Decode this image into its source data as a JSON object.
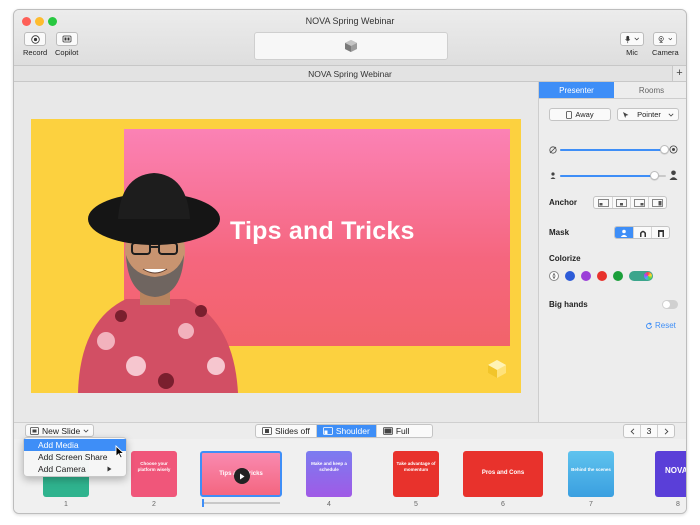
{
  "window": {
    "title": "NOVA Spring Webinar"
  },
  "toolbar": {
    "record_label": "Record",
    "copilot_label": "Copilot",
    "mic_label": "Mic",
    "camera_label": "Camera"
  },
  "subbar": {
    "title": "NOVA Spring Webinar",
    "add_symbol": "+"
  },
  "slide": {
    "title": "Tips and Tricks"
  },
  "panel": {
    "tabs": [
      "Presenter",
      "Rooms"
    ],
    "away_label": "Away",
    "pointer_label": "Pointer",
    "opacity_level": 1.0,
    "size_level": 0.89,
    "anchor_label": "Anchor",
    "mask_label": "Mask",
    "colorize_label": "Colorize",
    "colorize_colors": [
      "#2d5bd8",
      "#9b3fd8",
      "#e8322c",
      "#1b9f3a"
    ],
    "big_hands_label": "Big hands",
    "big_hands_on": false,
    "reset_label": "Reset"
  },
  "bottom": {
    "new_slide_label": "New Slide",
    "modes": [
      "Slides off",
      "Shoulder",
      "Full"
    ],
    "active_mode": "Shoulder",
    "page": "3"
  },
  "menu": {
    "items": [
      "Add Media",
      "Add Screen Share",
      "Add Camera"
    ],
    "highlighted": "Add Media"
  },
  "thumbs": [
    {
      "num": "1",
      "color": "#2fb38e",
      "text": ""
    },
    {
      "num": "2",
      "color": "#f0567a",
      "text": "Choose your platform wisely"
    },
    {
      "num": "",
      "color": "#f36a8a",
      "text": "Tips and Tricks"
    },
    {
      "num": "4",
      "color": "#6a5ce8",
      "text": "Make and keep a schedule"
    },
    {
      "num": "5",
      "color": "#e8322c",
      "text": "Take advantage of momentum"
    },
    {
      "num": "6",
      "color": "#e8322c",
      "text": "Pros and Cons"
    },
    {
      "num": "7",
      "color": "#4ab3e8",
      "text": "Behind the scenes"
    },
    {
      "num": "8",
      "color": "#5a3fd8",
      "text": "NOVA"
    }
  ]
}
